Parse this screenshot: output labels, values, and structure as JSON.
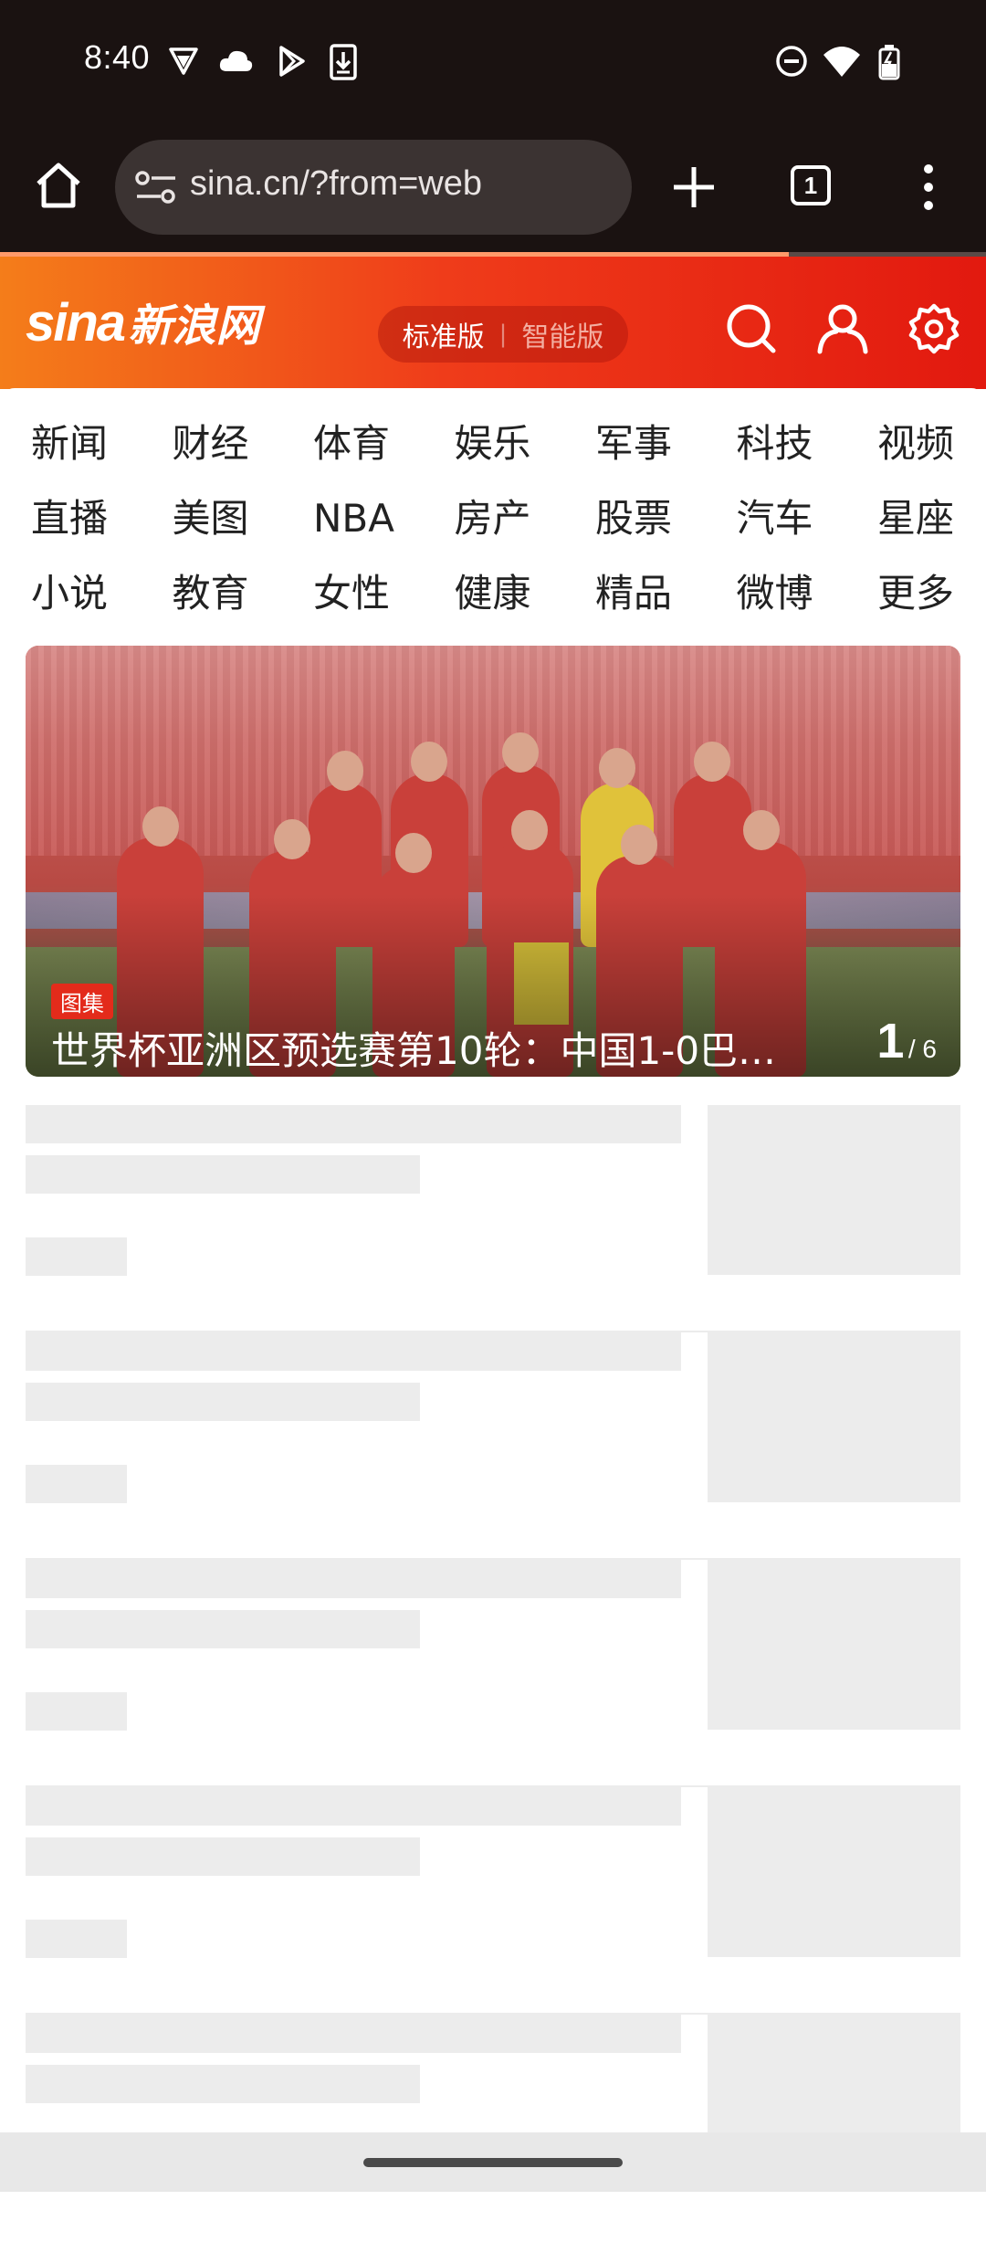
{
  "status_bar": {
    "time": "8:40",
    "icons_left": [
      "vpn-shield-icon",
      "cloud-icon",
      "play-store-icon",
      "download-icon"
    ],
    "icons_right": [
      "do-not-disturb-icon",
      "wifi-icon",
      "battery-charging-icon"
    ]
  },
  "browser": {
    "url": "sina.cn/?from=web",
    "tab_count": "1",
    "load_progress": 0.8
  },
  "header": {
    "logo_sina": "sina",
    "logo_cn": "新浪网",
    "version_active": "标准版",
    "version_inactive": "智能版"
  },
  "nav": {
    "items": [
      "新闻",
      "财经",
      "体育",
      "娱乐",
      "军事",
      "科技",
      "视频",
      "直播",
      "美图",
      "NBA",
      "房产",
      "股票",
      "汽车",
      "星座",
      "小说",
      "教育",
      "女性",
      "健康",
      "精品",
      "微博",
      "更多"
    ]
  },
  "featured": {
    "badge": "图集",
    "title": "世界杯亚洲区预选赛第10轮：中国1-0巴…",
    "current": "1",
    "total": "/ 6"
  },
  "colors": {
    "accent": "#e32b1b",
    "header_start": "#f47d1a",
    "header_end": "#e2190f",
    "skeleton": "#ececec",
    "toolbar": "#1a1211"
  }
}
